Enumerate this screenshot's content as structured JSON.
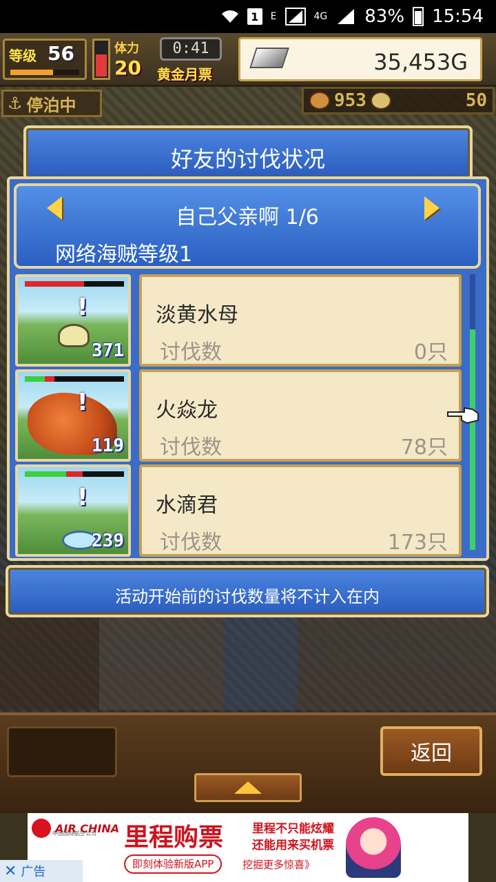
{
  "status_bar": {
    "sim_badge": "1",
    "net_e": "E",
    "net_4g": "4G",
    "battery_pct": "83%",
    "time": "15:54"
  },
  "hud": {
    "level_label": "等级",
    "level_value": "56",
    "stamina_label": "体力",
    "stamina_value": "20",
    "timer": "0:41",
    "pass_label": "黄金月票",
    "gold": "35,453G",
    "status_label": "停泊中",
    "resource_1": "953",
    "resource_2": "50"
  },
  "dialog": {
    "title": "好友的讨伐状况",
    "friend_name": "自己父亲啊 1/6",
    "pirate_level": "网络海贼等级1",
    "monsters": [
      {
        "name": "淡黄水母",
        "kill_label": "讨伐数",
        "kill_count": "0只",
        "number": "371",
        "hp_red": 0.6,
        "hp_green": 0.0
      },
      {
        "name": "火焱龙",
        "kill_label": "讨伐数",
        "kill_count": "78只",
        "number": "119",
        "hp_red": 0.1,
        "hp_green": 0.2
      },
      {
        "name": "水滴君",
        "kill_label": "讨伐数",
        "kill_count": "173只",
        "number": "239",
        "hp_red": 0.16,
        "hp_green": 0.42
      }
    ],
    "note": "活动开始前的讨伐数量将不计入在内"
  },
  "bottom": {
    "back_label": "返回"
  },
  "ad": {
    "brand": "AIR CHINA",
    "brand_sub": "中国国际航空公司",
    "headline": "里程购票",
    "sub1": "里程不只能炫耀",
    "sub2": "还能用来买机票",
    "cta": "即刻体验新版APP",
    "more": "挖掘更多惊喜》",
    "close_label": "广告"
  },
  "colors": {
    "panel_blue": "#2a5cbe",
    "card_bg": "#f4e8c6",
    "gold_yellow": "#ffd24a"
  }
}
